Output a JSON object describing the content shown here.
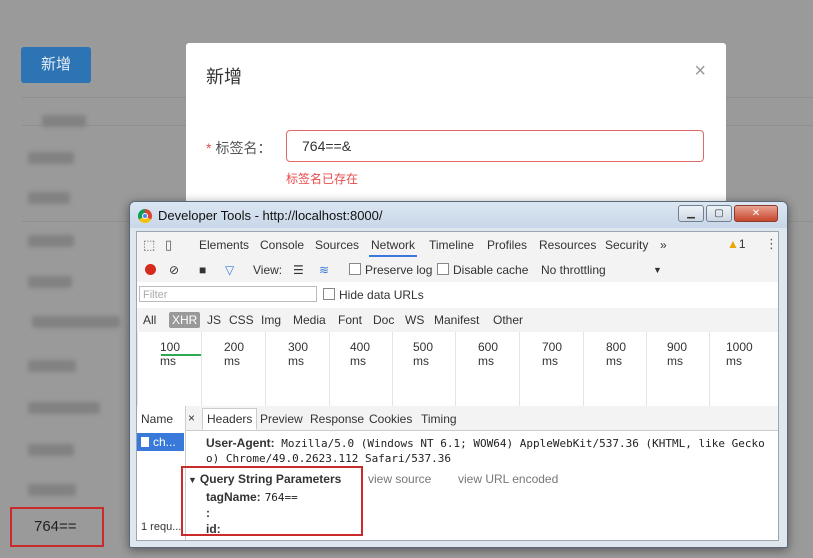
{
  "app": {
    "add_button_label": "新增",
    "highlighted_cell_value": "764=="
  },
  "modal": {
    "title": "新增",
    "close_label": "×",
    "field_required_mark": "*",
    "field_label": "标签名：",
    "field_value": "764==&",
    "field_error": "标签名已存在"
  },
  "devtools": {
    "window_title": "Developer Tools - http://localhost:8000/",
    "window_buttons": {
      "minimize": "▁",
      "maximize": "▢",
      "close": "✕"
    },
    "tabs": [
      "Elements",
      "Console",
      "Sources",
      "Network",
      "Timeline",
      "Profiles",
      "Resources",
      "Security",
      "»"
    ],
    "active_tab": "Network",
    "warning_count": "1",
    "toolbar": {
      "view_label": "View:",
      "preserve_log": "Preserve log",
      "disable_cache": "Disable cache",
      "throttling": "No throttling",
      "throttle_arrow": "▼"
    },
    "filter_placeholder": "Filter",
    "hide_data_urls": "Hide data URLs",
    "type_filters": [
      "All",
      "XHR",
      "JS",
      "CSS",
      "Img",
      "Media",
      "Font",
      "Doc",
      "WS",
      "Manifest",
      "Other"
    ],
    "active_type": "XHR",
    "timeline_ticks": [
      "100 ms",
      "200 ms",
      "300 ms",
      "400 ms",
      "500 ms",
      "600 ms",
      "700 ms",
      "800 ms",
      "900 ms",
      "1000 ms"
    ],
    "name_column_header": "Name",
    "request_name": "ch...",
    "requests_footer": "1 requ...",
    "detail_tabs": [
      "Headers",
      "Preview",
      "Response",
      "Cookies",
      "Timing"
    ],
    "active_detail_tab": "Headers",
    "close_detail": "×",
    "user_agent_key": "User-Agent:",
    "user_agent_line1": "Mozilla/5.0 (Windows NT 6.1; WOW64) AppleWebKit/537.36 (KHTML, like Gecko",
    "user_agent_line2": "o) Chrome/49.0.2623.112 Safari/537.36",
    "query_section_title": "Query String Parameters",
    "view_source": "view source",
    "view_url_encoded": "view URL encoded",
    "params": [
      {
        "key": "tagName:",
        "value": "764=="
      },
      {
        "key": ":",
        "value": ""
      },
      {
        "key": "id:",
        "value": ""
      }
    ]
  }
}
